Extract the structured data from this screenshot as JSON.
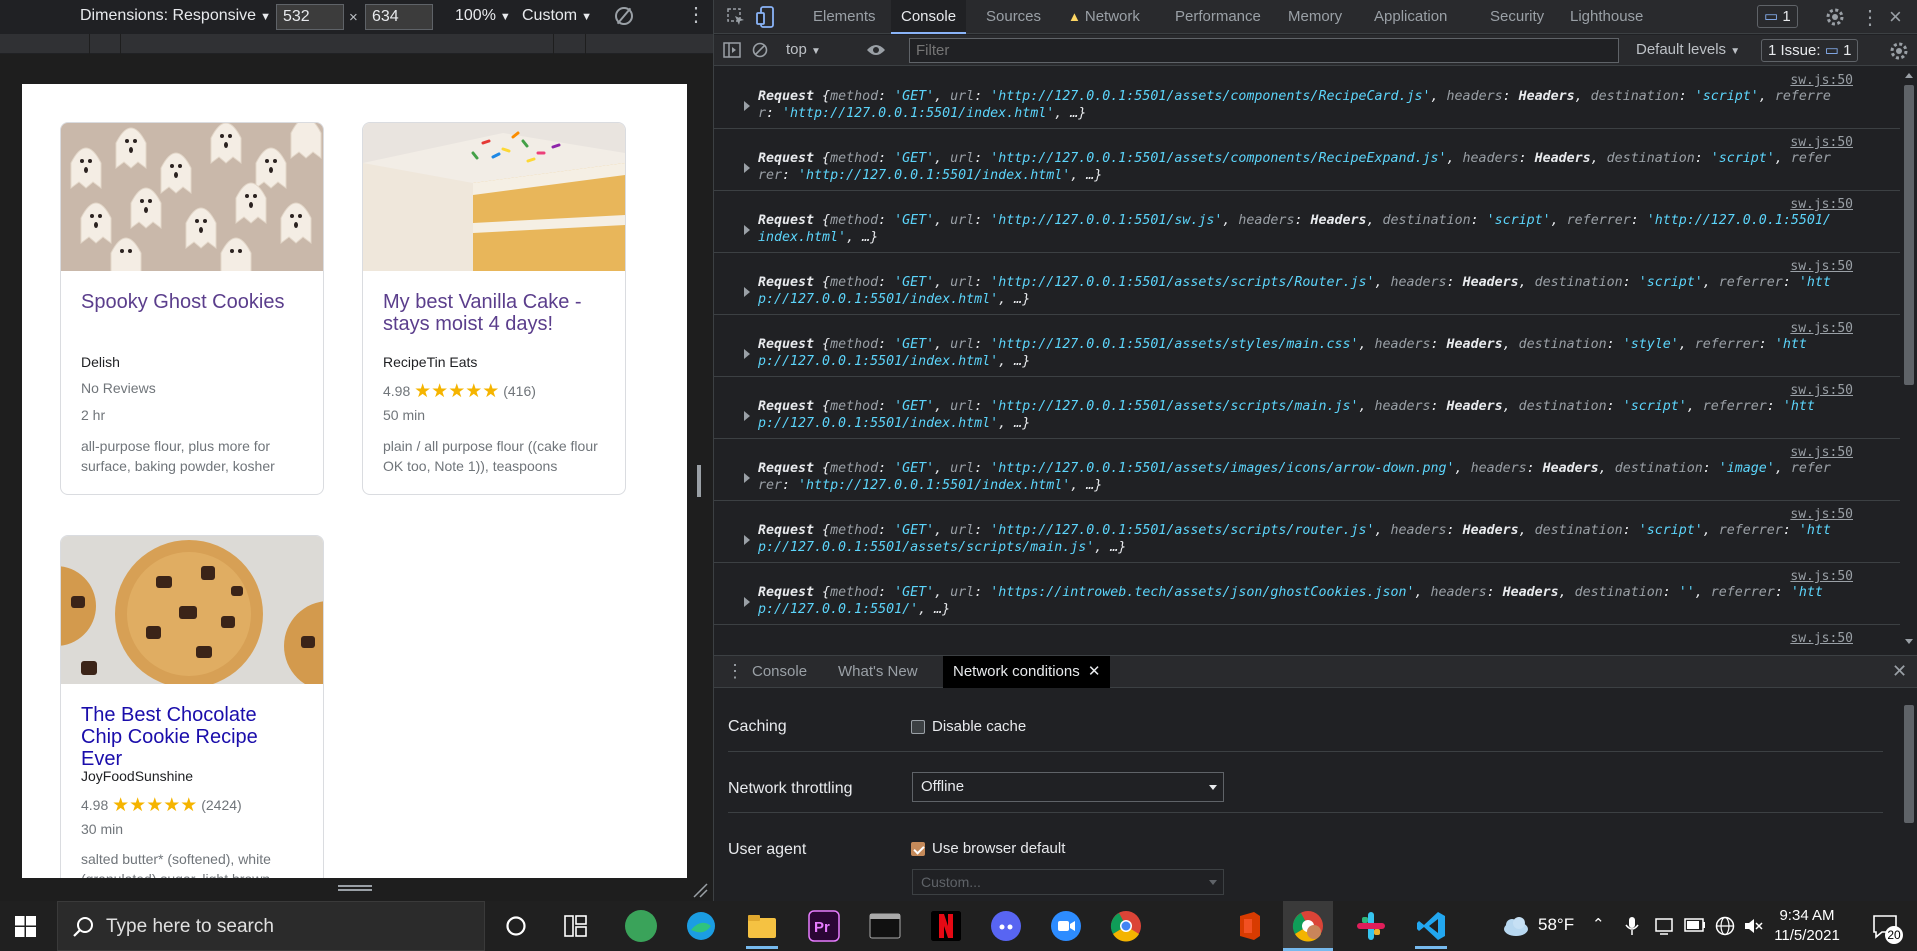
{
  "device_toolbar": {
    "dimensions_label": "Dimensions: Responsive",
    "width_value": "532",
    "height_value": "634",
    "times": "×",
    "zoom": "100%",
    "throttle": "Custom"
  },
  "recipes": [
    {
      "title": "Spooky Ghost Cookies",
      "source": "Delish",
      "rating": "",
      "stars": "",
      "reviews": "No Reviews",
      "time": "2 hr",
      "ingredients": "all-purpose flour, plus more for surface, baking powder, kosher"
    },
    {
      "title": "My best Vanilla Cake - stays moist 4 days!",
      "source": "RecipeTin Eats",
      "rating": "4.98",
      "stars": "★★★★★",
      "reviews": "(416)",
      "time": "50 min",
      "ingredients": "plain / all purpose flour ((cake flour OK too, Note 1)), teaspoons"
    },
    {
      "title": "The Best Chocolate Chip Cookie Recipe Ever",
      "source": "JoyFoodSunshine",
      "rating": "4.98",
      "stars": "★★★★★",
      "reviews": "(2424)",
      "time": "30 min",
      "ingredients": "salted butter* (softened), white (granulated) sugar, light brown"
    }
  ],
  "devtools": {
    "tabs": [
      "Elements",
      "Console",
      "Sources",
      "Network",
      "Performance",
      "Memory",
      "Application",
      "Security",
      "Lighthouse"
    ],
    "message_count": "1",
    "context": "top",
    "filter_placeholder": "Filter",
    "levels": "Default levels",
    "issues_label": "1 Issue:",
    "issues_count": "1",
    "console_entries": [
      {
        "src": "sw.js:50",
        "l1": [
          [
            "o",
            "Request "
          ],
          [
            "p",
            "{"
          ],
          [
            "k",
            "method"
          ],
          [
            "p",
            ": "
          ],
          [
            "s",
            "'GET'"
          ],
          [
            "p",
            ", "
          ],
          [
            "k",
            "url"
          ],
          [
            "p",
            ": "
          ],
          [
            "s",
            "'http://127.0.0.1:5501/assets/components/RecipeCard.js'"
          ],
          [
            "p",
            ", "
          ],
          [
            "k",
            "headers"
          ],
          [
            "p",
            ": "
          ],
          [
            "o",
            "Headers"
          ],
          [
            "p",
            ", "
          ],
          [
            "k",
            "destination"
          ],
          [
            "p",
            ": "
          ],
          [
            "s",
            "'script'"
          ],
          [
            "p",
            ", "
          ],
          [
            "k",
            "referre"
          ]
        ],
        "l2": [
          [
            "k",
            "r"
          ],
          [
            "p",
            ": "
          ],
          [
            "s",
            "'http://127.0.0.1:5501/index.html'"
          ],
          [
            "p",
            ", …}"
          ]
        ]
      },
      {
        "src": "sw.js:50",
        "l1": [
          [
            "o",
            "Request "
          ],
          [
            "p",
            "{"
          ],
          [
            "k",
            "method"
          ],
          [
            "p",
            ": "
          ],
          [
            "s",
            "'GET'"
          ],
          [
            "p",
            ", "
          ],
          [
            "k",
            "url"
          ],
          [
            "p",
            ": "
          ],
          [
            "s",
            "'http://127.0.0.1:5501/assets/components/RecipeExpand.js'"
          ],
          [
            "p",
            ", "
          ],
          [
            "k",
            "headers"
          ],
          [
            "p",
            ": "
          ],
          [
            "o",
            "Headers"
          ],
          [
            "p",
            ", "
          ],
          [
            "k",
            "destination"
          ],
          [
            "p",
            ": "
          ],
          [
            "s",
            "'script'"
          ],
          [
            "p",
            ", "
          ],
          [
            "k",
            "refer"
          ]
        ],
        "l2": [
          [
            "k",
            "rer"
          ],
          [
            "p",
            ": "
          ],
          [
            "s",
            "'http://127.0.0.1:5501/index.html'"
          ],
          [
            "p",
            ", …}"
          ]
        ]
      },
      {
        "src": "sw.js:50",
        "l1": [
          [
            "o",
            "Request "
          ],
          [
            "p",
            "{"
          ],
          [
            "k",
            "method"
          ],
          [
            "p",
            ": "
          ],
          [
            "s",
            "'GET'"
          ],
          [
            "p",
            ", "
          ],
          [
            "k",
            "url"
          ],
          [
            "p",
            ": "
          ],
          [
            "s",
            "'http://127.0.0.1:5501/sw.js'"
          ],
          [
            "p",
            ", "
          ],
          [
            "k",
            "headers"
          ],
          [
            "p",
            ": "
          ],
          [
            "o",
            "Headers"
          ],
          [
            "p",
            ", "
          ],
          [
            "k",
            "destination"
          ],
          [
            "p",
            ": "
          ],
          [
            "s",
            "'script'"
          ],
          [
            "p",
            ", "
          ],
          [
            "k",
            "referrer"
          ],
          [
            "p",
            ": "
          ],
          [
            "s",
            "'http://127.0.0.1:5501/"
          ]
        ],
        "l2": [
          [
            "s",
            "index.html'"
          ],
          [
            "p",
            ", …}"
          ]
        ]
      },
      {
        "src": "sw.js:50",
        "l1": [
          [
            "o",
            "Request "
          ],
          [
            "p",
            "{"
          ],
          [
            "k",
            "method"
          ],
          [
            "p",
            ": "
          ],
          [
            "s",
            "'GET'"
          ],
          [
            "p",
            ", "
          ],
          [
            "k",
            "url"
          ],
          [
            "p",
            ": "
          ],
          [
            "s",
            "'http://127.0.0.1:5501/assets/scripts/Router.js'"
          ],
          [
            "p",
            ", "
          ],
          [
            "k",
            "headers"
          ],
          [
            "p",
            ": "
          ],
          [
            "o",
            "Headers"
          ],
          [
            "p",
            ", "
          ],
          [
            "k",
            "destination"
          ],
          [
            "p",
            ": "
          ],
          [
            "s",
            "'script'"
          ],
          [
            "p",
            ", "
          ],
          [
            "k",
            "referrer"
          ],
          [
            "p",
            ": "
          ],
          [
            "s",
            "'htt"
          ]
        ],
        "l2": [
          [
            "s",
            "p://127.0.0.1:5501/index.html'"
          ],
          [
            "p",
            ", …}"
          ]
        ]
      },
      {
        "src": "sw.js:50",
        "l1": [
          [
            "o",
            "Request "
          ],
          [
            "p",
            "{"
          ],
          [
            "k",
            "method"
          ],
          [
            "p",
            ": "
          ],
          [
            "s",
            "'GET'"
          ],
          [
            "p",
            ", "
          ],
          [
            "k",
            "url"
          ],
          [
            "p",
            ": "
          ],
          [
            "s",
            "'http://127.0.0.1:5501/assets/styles/main.css'"
          ],
          [
            "p",
            ", "
          ],
          [
            "k",
            "headers"
          ],
          [
            "p",
            ": "
          ],
          [
            "o",
            "Headers"
          ],
          [
            "p",
            ", "
          ],
          [
            "k",
            "destination"
          ],
          [
            "p",
            ": "
          ],
          [
            "s",
            "'style'"
          ],
          [
            "p",
            ", "
          ],
          [
            "k",
            "referrer"
          ],
          [
            "p",
            ": "
          ],
          [
            "s",
            "'htt"
          ]
        ],
        "l2": [
          [
            "s",
            "p://127.0.0.1:5501/index.html'"
          ],
          [
            "p",
            ", …}"
          ]
        ]
      },
      {
        "src": "sw.js:50",
        "l1": [
          [
            "o",
            "Request "
          ],
          [
            "p",
            "{"
          ],
          [
            "k",
            "method"
          ],
          [
            "p",
            ": "
          ],
          [
            "s",
            "'GET'"
          ],
          [
            "p",
            ", "
          ],
          [
            "k",
            "url"
          ],
          [
            "p",
            ": "
          ],
          [
            "s",
            "'http://127.0.0.1:5501/assets/scripts/main.js'"
          ],
          [
            "p",
            ", "
          ],
          [
            "k",
            "headers"
          ],
          [
            "p",
            ": "
          ],
          [
            "o",
            "Headers"
          ],
          [
            "p",
            ", "
          ],
          [
            "k",
            "destination"
          ],
          [
            "p",
            ": "
          ],
          [
            "s",
            "'script'"
          ],
          [
            "p",
            ", "
          ],
          [
            "k",
            "referrer"
          ],
          [
            "p",
            ": "
          ],
          [
            "s",
            "'htt"
          ]
        ],
        "l2": [
          [
            "s",
            "p://127.0.0.1:5501/index.html'"
          ],
          [
            "p",
            ", …}"
          ]
        ]
      },
      {
        "src": "sw.js:50",
        "l1": [
          [
            "o",
            "Request "
          ],
          [
            "p",
            "{"
          ],
          [
            "k",
            "method"
          ],
          [
            "p",
            ": "
          ],
          [
            "s",
            "'GET'"
          ],
          [
            "p",
            ", "
          ],
          [
            "k",
            "url"
          ],
          [
            "p",
            ": "
          ],
          [
            "s",
            "'http://127.0.0.1:5501/assets/images/icons/arrow-down.png'"
          ],
          [
            "p",
            ", "
          ],
          [
            "k",
            "headers"
          ],
          [
            "p",
            ": "
          ],
          [
            "o",
            "Headers"
          ],
          [
            "p",
            ", "
          ],
          [
            "k",
            "destination"
          ],
          [
            "p",
            ": "
          ],
          [
            "s",
            "'image'"
          ],
          [
            "p",
            ", "
          ],
          [
            "k",
            "refer"
          ]
        ],
        "l2": [
          [
            "k",
            "rer"
          ],
          [
            "p",
            ": "
          ],
          [
            "s",
            "'http://127.0.0.1:5501/index.html'"
          ],
          [
            "p",
            ", …}"
          ]
        ]
      },
      {
        "src": "sw.js:50",
        "l1": [
          [
            "o",
            "Request "
          ],
          [
            "p",
            "{"
          ],
          [
            "k",
            "method"
          ],
          [
            "p",
            ": "
          ],
          [
            "s",
            "'GET'"
          ],
          [
            "p",
            ", "
          ],
          [
            "k",
            "url"
          ],
          [
            "p",
            ": "
          ],
          [
            "s",
            "'http://127.0.0.1:5501/assets/scripts/router.js'"
          ],
          [
            "p",
            ", "
          ],
          [
            "k",
            "headers"
          ],
          [
            "p",
            ": "
          ],
          [
            "o",
            "Headers"
          ],
          [
            "p",
            ", "
          ],
          [
            "k",
            "destination"
          ],
          [
            "p",
            ": "
          ],
          [
            "s",
            "'script'"
          ],
          [
            "p",
            ", "
          ],
          [
            "k",
            "referrer"
          ],
          [
            "p",
            ": "
          ],
          [
            "s",
            "'htt"
          ]
        ],
        "l2": [
          [
            "s",
            "p://127.0.0.1:5501/assets/scripts/main.js'"
          ],
          [
            "p",
            ", …}"
          ]
        ]
      },
      {
        "src": "sw.js:50",
        "l1": [
          [
            "o",
            "Request "
          ],
          [
            "p",
            "{"
          ],
          [
            "k",
            "method"
          ],
          [
            "p",
            ": "
          ],
          [
            "s",
            "'GET'"
          ],
          [
            "p",
            ", "
          ],
          [
            "k",
            "url"
          ],
          [
            "p",
            ": "
          ],
          [
            "s",
            "'https://introweb.tech/assets/json/ghostCookies.json'"
          ],
          [
            "p",
            ", "
          ],
          [
            "k",
            "headers"
          ],
          [
            "p",
            ": "
          ],
          [
            "o",
            "Headers"
          ],
          [
            "p",
            ", "
          ],
          [
            "k",
            "destination"
          ],
          [
            "p",
            ": "
          ],
          [
            "s",
            "''"
          ],
          [
            "p",
            ", "
          ],
          [
            "k",
            "referrer"
          ],
          [
            "p",
            ": "
          ],
          [
            "s",
            "'htt"
          ]
        ],
        "l2": [
          [
            "s",
            "p://127.0.0.1:5501/'"
          ],
          [
            "p",
            ", …}"
          ]
        ]
      },
      {
        "src": "sw.js:50",
        "l1": [],
        "l2": []
      }
    ],
    "drawer_tabs": [
      "Console",
      "What's New",
      "Network conditions"
    ],
    "caching_label": "Caching",
    "disable_cache_label": "Disable cache",
    "throttling_label": "Network throttling",
    "throttling_value": "Offline",
    "user_agent_label": "User agent",
    "use_default_label": "Use browser default",
    "custom_placeholder": "Custom..."
  },
  "taskbar": {
    "search_placeholder": "Type here to search",
    "weather": "58°F",
    "time": "9:34 AM",
    "date": "11/5/2021",
    "notifications": "20"
  },
  "colors": {
    "accent": "#8ab4f8",
    "string": "#5cd5fb",
    "star": "#f5b400",
    "title_purple": "#5b3e8c",
    "title_blue": "#1a0dab"
  }
}
